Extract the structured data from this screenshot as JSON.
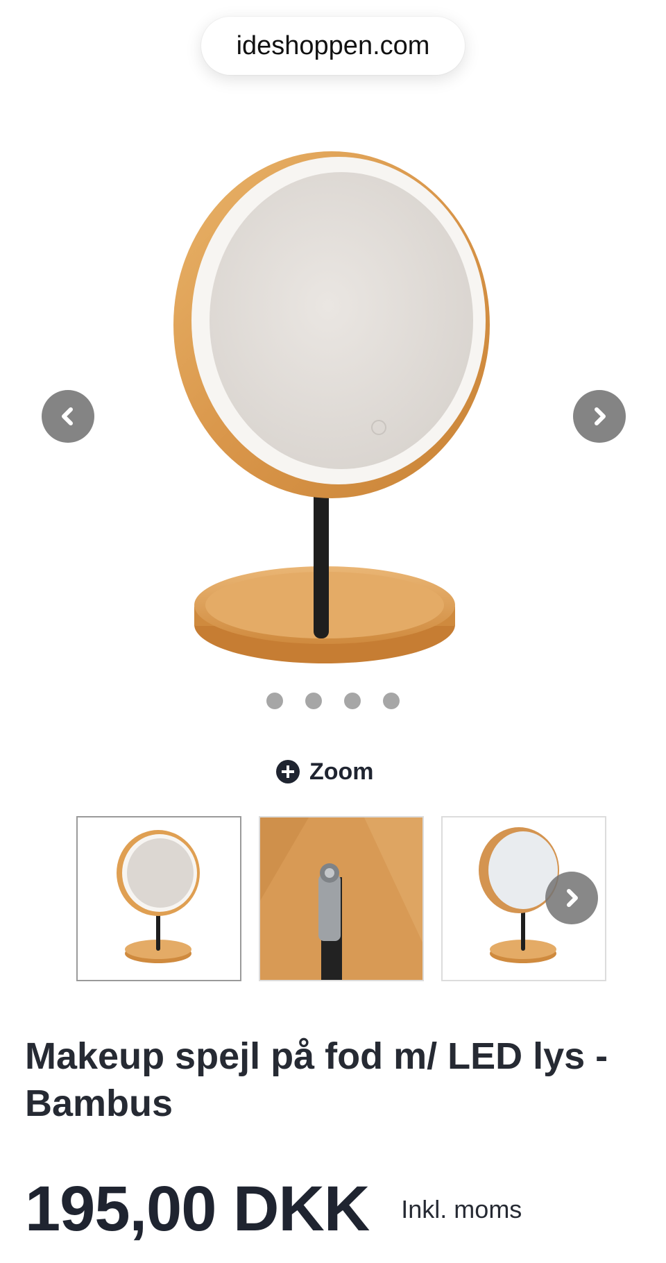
{
  "browser": {
    "url": "ideshoppen.com"
  },
  "gallery": {
    "prev_icon": "chevron-left-icon",
    "next_icon": "chevron-right-icon",
    "dots_count": 4,
    "zoom_label": "Zoom",
    "zoom_icon": "plus-circle-icon",
    "thumbnails": [
      {
        "name": "thumbnail-mirror-front",
        "active": true
      },
      {
        "name": "thumbnail-joint-detail",
        "active": false
      },
      {
        "name": "thumbnail-mirror-angle",
        "active": false
      }
    ]
  },
  "product": {
    "title": "Makeup spejl på fod m/ LED lys - Bambus",
    "price": "195,00 DKK",
    "vat_note": "Inkl. moms"
  },
  "colors": {
    "text": "#1f2430",
    "bamboo": "#e0a45a",
    "nav_button": "#6e6e6e"
  }
}
